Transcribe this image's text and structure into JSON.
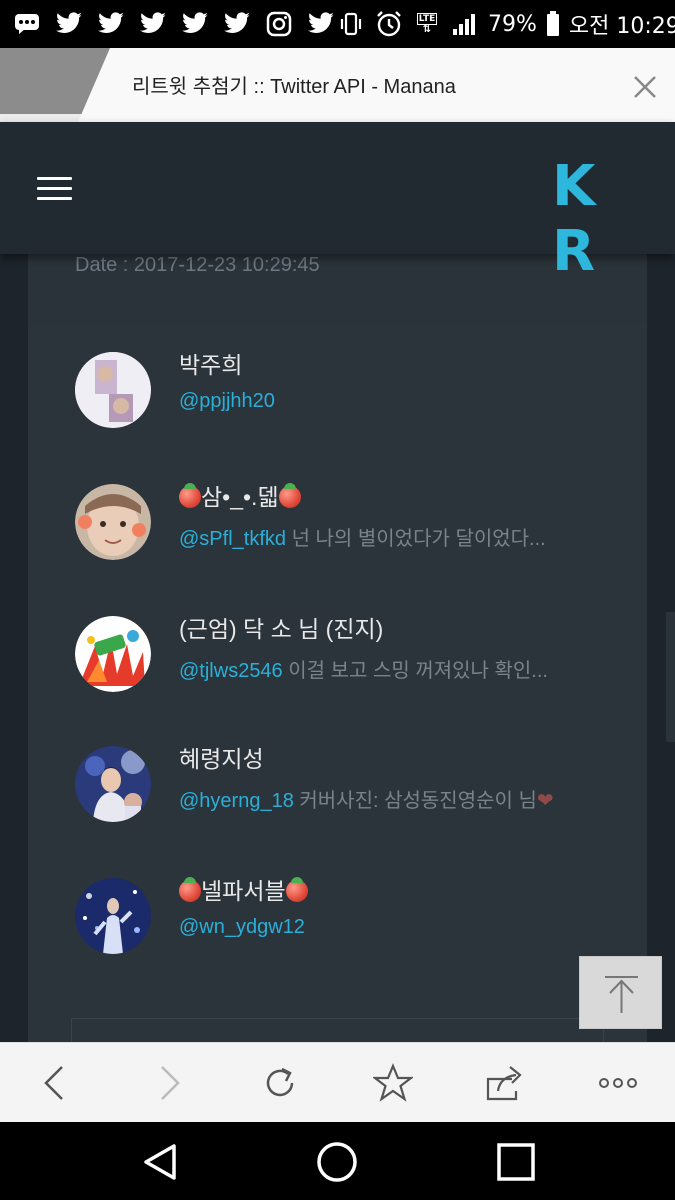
{
  "status_bar": {
    "icons": [
      "message-icon",
      "twitter-icon",
      "twitter-icon",
      "twitter-icon",
      "twitter-icon",
      "twitter-icon",
      "instagram-icon",
      "twitter-icon",
      "vibrate-icon",
      "alarm-icon",
      "lte-signal-icon",
      "signal-bars-icon",
      "battery-icon"
    ],
    "lte_label": "LTE",
    "battery": "79%",
    "time": "오전 10:29"
  },
  "browser": {
    "tab_title": "리트윗 추첨기 :: Twitter API - Manana"
  },
  "header": {
    "brand": "K R"
  },
  "page": {
    "date": "Date : 2017-12-23 10:29:45"
  },
  "users": [
    {
      "name": "박주희",
      "handle": "@ppjjhh20",
      "bio": ""
    },
    {
      "name": "삼•_•.덻",
      "handle": "@sPfl_tkfkd",
      "bio": " 넌 나의 별이었다가 달이었다..."
    },
    {
      "name": "(근엄) 닥 소 님 (진지)",
      "handle": "@tjlws2546",
      "bio": " 이걸 보고 스밍 꺼져있나 확인..."
    },
    {
      "name": "혜령지성",
      "handle": "@hyerng_18",
      "bio": " 커버사진: 삼성동진영순이 님"
    },
    {
      "name": "넬파서블",
      "handle": "@wn_ydgw12",
      "bio": ""
    }
  ],
  "colors": {
    "accent": "#2db7dd",
    "handle": "#2ab0d8",
    "header_bg": "#222a31",
    "panel_bg": "#2b333b"
  }
}
